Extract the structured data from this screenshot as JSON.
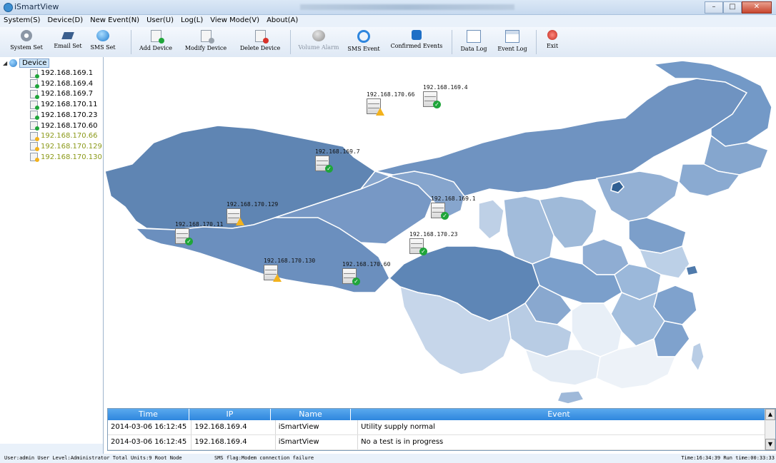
{
  "window": {
    "title": "iSmartView"
  },
  "menu": [
    {
      "label": "System(S)"
    },
    {
      "label": "Device(D)"
    },
    {
      "label": "New Event(N)"
    },
    {
      "label": "User(U)"
    },
    {
      "label": "Log(L)"
    },
    {
      "label": "View Mode(V)"
    },
    {
      "label": "About(A)"
    }
  ],
  "toolbar": {
    "system_set": "System Set",
    "email_set": "Email Set",
    "sms_set": "SMS Set",
    "add_device": "Add Device",
    "modify_device": "Modify Device",
    "delete_device": "Delete Device",
    "volume_alarm": "Volume Alarm",
    "sms_event": "SMS Event",
    "confirmed_events": "Confirmed Events",
    "data_log": "Data Log",
    "event_log": "Event Log",
    "exit": "Exit"
  },
  "tree": {
    "root": "Device",
    "items": [
      {
        "ip": "192.168.169.1",
        "status": "ok"
      },
      {
        "ip": "192.168.169.4",
        "status": "ok"
      },
      {
        "ip": "192.168.169.7",
        "status": "ok"
      },
      {
        "ip": "192.168.170.11",
        "status": "ok"
      },
      {
        "ip": "192.168.170.23",
        "status": "ok"
      },
      {
        "ip": "192.168.170.60",
        "status": "ok"
      },
      {
        "ip": "192.168.170.66",
        "status": "warning"
      },
      {
        "ip": "192.168.170.129",
        "status": "warning"
      },
      {
        "ip": "192.168.170.130",
        "status": "warning"
      }
    ]
  },
  "map_markers": [
    {
      "ip": "192.168.170.66",
      "status": "warning"
    },
    {
      "ip": "192.168.169.4",
      "status": "ok"
    },
    {
      "ip": "192.168.169.7",
      "status": "ok"
    },
    {
      "ip": "192.168.169.1",
      "status": "ok"
    },
    {
      "ip": "192.168.170.129",
      "status": "warning"
    },
    {
      "ip": "192.168.170.11",
      "status": "ok"
    },
    {
      "ip": "192.168.170.23",
      "status": "ok"
    },
    {
      "ip": "192.168.170.130",
      "status": "warning"
    },
    {
      "ip": "192.168.170.60",
      "status": "ok"
    }
  ],
  "events": {
    "headers": {
      "time": "Time",
      "ip": "IP",
      "name": "Name",
      "event": "Event"
    },
    "rows": [
      {
        "time": "2014-03-06 16:12:45",
        "ip": "192.168.169.4",
        "name": "iSmartView",
        "event": "Utility supply normal"
      },
      {
        "time": "2014-03-06 16:12:45",
        "ip": "192.168.169.4",
        "name": "iSmartView",
        "event": "No a test is in progress"
      }
    ]
  },
  "status": {
    "left": "User:admin User Level:Administrator Total Units:9 Root Node",
    "sms": "SMS flag:Modem connection failure",
    "right": "Time:16:34:39 Run time:00:33:33"
  },
  "colors": {
    "ok": "#1fa53a",
    "warning": "#f3b21c",
    "header": "#2e86de"
  }
}
